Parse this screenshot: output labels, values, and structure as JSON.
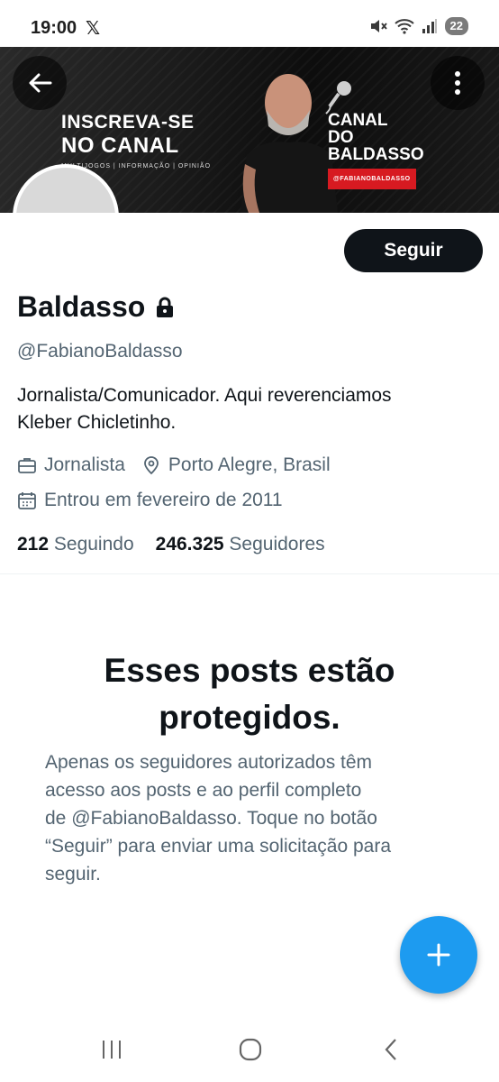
{
  "status_bar": {
    "time": "19:00",
    "app_glyph": "𝕏",
    "battery": "22",
    "icons": [
      "mute-icon",
      "wifi-icon",
      "signal-icon"
    ]
  },
  "banner": {
    "cta_line1": "INSCREVA-SE",
    "cta_line2": "NO CANAL",
    "cta_sub": "MULTIJOGOS | INFORMAÇÃO | OPINIÃO",
    "brand_line1": "CANAL",
    "brand_line2": "DO",
    "brand_line3": "BALDASSO",
    "brand_tag": "@FABIANOBALDASSO"
  },
  "profile": {
    "follow_label": "Seguir",
    "display_name": "Baldasso",
    "handle": "@FabianoBaldasso",
    "bio_line1": "Jornalista/Comunicador. Aqui reverenciamos",
    "bio_line2": "Kleber Chicletinho.",
    "profession": "Jornalista",
    "location": "Porto Alegre, Brasil",
    "joined": "Entrou em fevereiro de 2011",
    "following_count": "212",
    "following_label": "Seguindo",
    "followers_count": "246.325",
    "followers_label": "Seguidores"
  },
  "protected": {
    "title_line1": "Esses posts estão",
    "title_line2": "protegidos.",
    "body_line1": "Apenas os seguidores autorizados têm",
    "body_line2": "acesso aos posts e ao perfil completo",
    "body_line3": "de @FabianoBaldasso. Toque no botão",
    "body_line4": "“Seguir” para enviar uma solicitação para",
    "body_line5": "seguir."
  },
  "colors": {
    "accent": "#1d9bf0",
    "text_primary": "#0f1419",
    "text_secondary": "#536471",
    "brand_red": "#d71a21"
  }
}
